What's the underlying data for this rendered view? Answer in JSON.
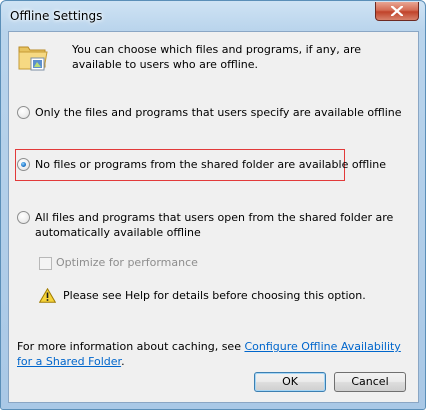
{
  "window": {
    "title": "Offline Settings",
    "close_icon": "close-icon"
  },
  "info": {
    "icon": "folder-icon",
    "text": "You can choose which files and programs, if any, are available to users who are offline."
  },
  "options": [
    {
      "label": "Only the files and programs that users specify are available offline",
      "checked": false
    },
    {
      "label": "No files or programs from the shared folder are available offline",
      "checked": true
    },
    {
      "label": "All files and programs that users open from the shared folder are automatically available offline",
      "checked": false
    }
  ],
  "optimize": {
    "label": "Optimize for performance",
    "checked": false,
    "disabled": true
  },
  "warning": {
    "icon": "warning-icon",
    "text": "Please see Help for details before choosing this option."
  },
  "footer": {
    "text": "For more information about caching, see ",
    "link": "Configure Offline Availability for a Shared Folder",
    "suffix": "."
  },
  "buttons": {
    "ok": "OK",
    "cancel": "Cancel"
  },
  "colors": {
    "highlight": "#e23a3a",
    "link": "#0066cc",
    "radio_selected": "#1f76c9"
  }
}
